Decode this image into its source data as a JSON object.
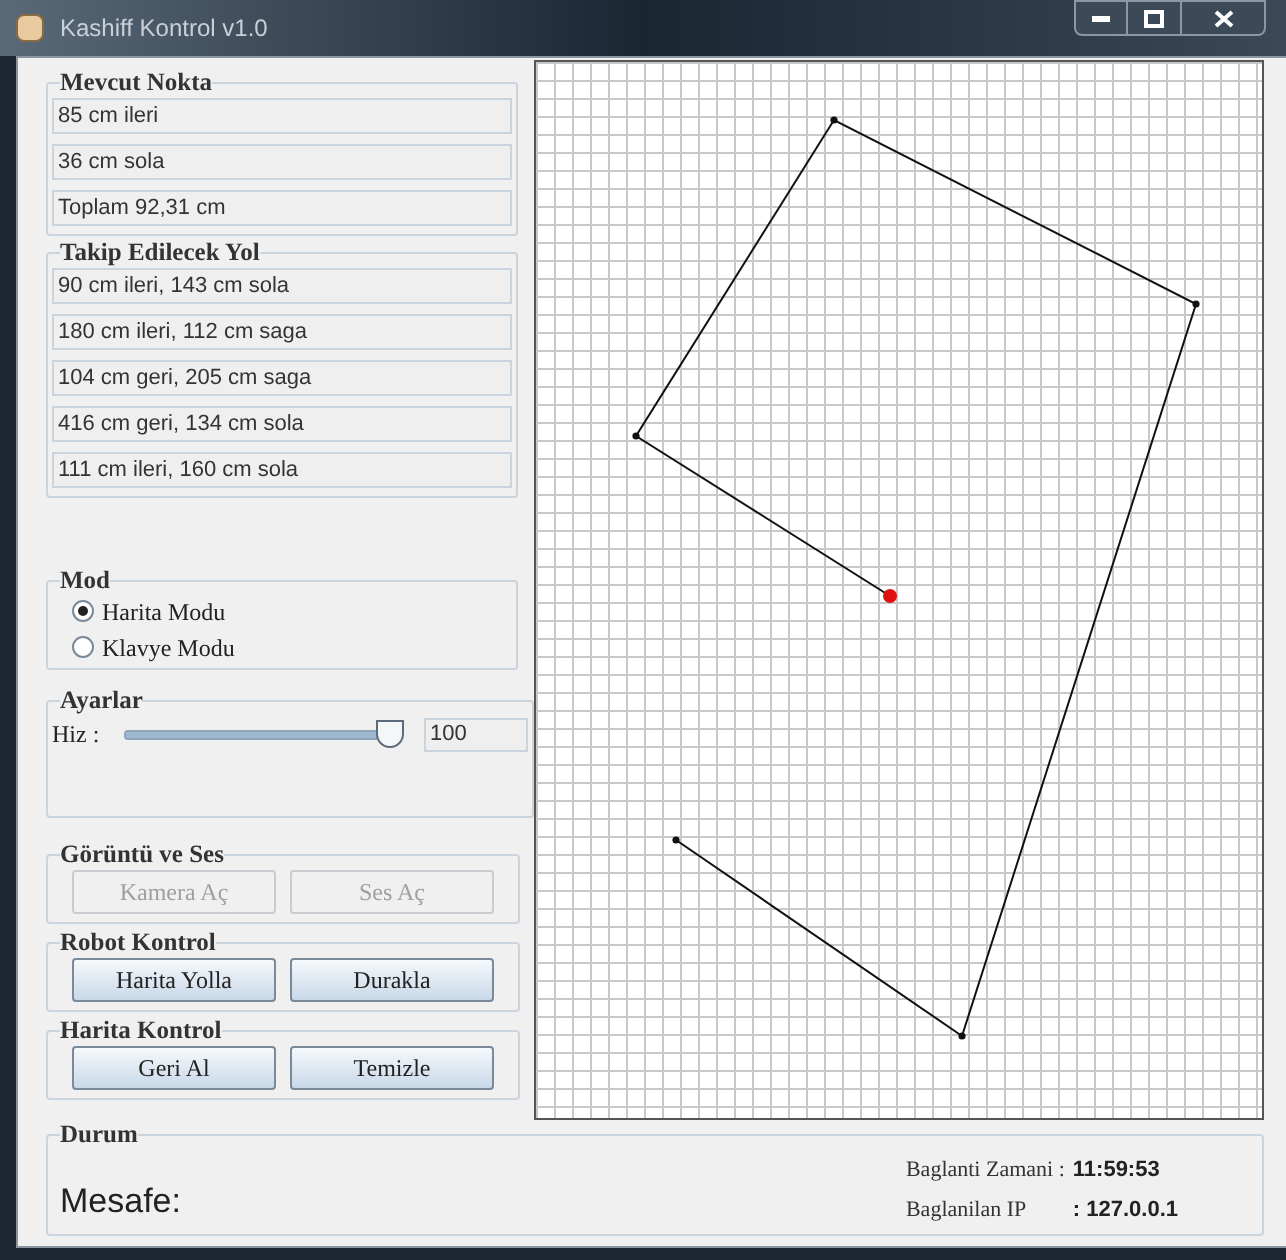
{
  "window": {
    "title": "Kashiff Kontrol v1.0"
  },
  "current_point": {
    "title": "Mevcut Nokta",
    "fields": [
      "85 cm ileri",
      "36 cm sola",
      "Toplam 92,31 cm"
    ]
  },
  "path_to_follow": {
    "title": "Takip Edilecek Yol",
    "fields": [
      "90 cm ileri, 143 cm sola",
      "180 cm ileri, 112 cm saga",
      "104 cm geri, 205 cm saga",
      "416 cm geri, 134 cm sola",
      "111 cm ileri, 160 cm sola"
    ]
  },
  "mode": {
    "title": "Mod",
    "options": [
      {
        "label": "Harita Modu",
        "selected": true
      },
      {
        "label": "Klavye Modu",
        "selected": false
      }
    ]
  },
  "settings": {
    "title": "Ayarlar",
    "speed": {
      "label": "Hiz :",
      "level": 1.0,
      "value": "100"
    }
  },
  "media": {
    "title": "Görüntü ve Ses",
    "buttons": [
      {
        "label": "Kamera Aç",
        "disabled": true
      },
      {
        "label": "Ses Aç",
        "disabled": true
      }
    ]
  },
  "robot_control": {
    "title": "Robot Kontrol",
    "buttons": [
      {
        "label": "Harita Yolla",
        "disabled": false
      },
      {
        "label": "Durakla",
        "disabled": false
      }
    ]
  },
  "map_control": {
    "title": "Harita Kontrol",
    "buttons": [
      {
        "label": "Geri Al",
        "disabled": false
      },
      {
        "label": "Temizle",
        "disabled": false
      }
    ]
  },
  "status": {
    "title": "Durum",
    "distance_label": "Mesafe:",
    "connection_time_label": "Baglanti Zamani :",
    "connection_time": "11:59:53",
    "ip_label": "Baglanilan IP",
    "ip": ": 127.0.0.1"
  }
}
